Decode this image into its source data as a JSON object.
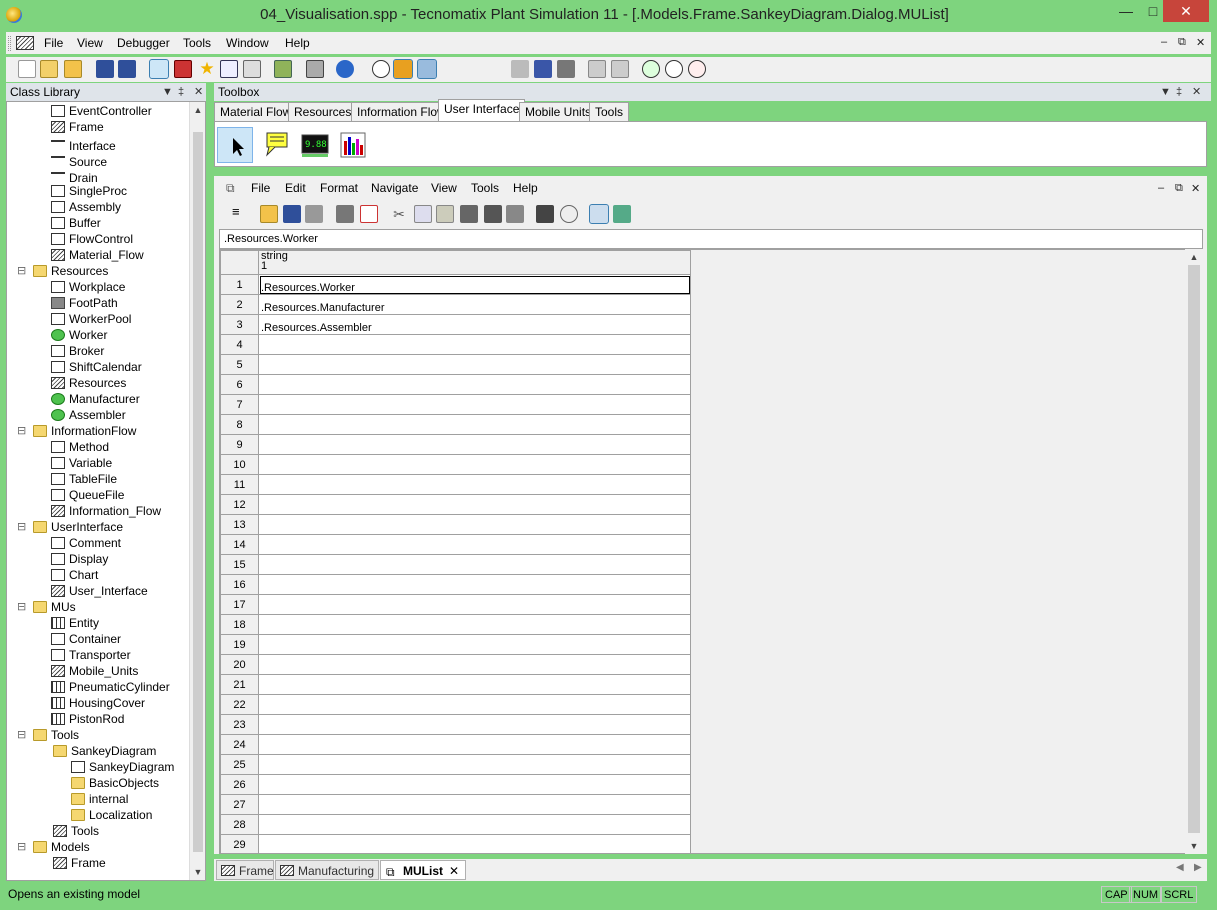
{
  "window": {
    "title": "04_Visualisation.spp - Tecnomatix Plant Simulation 11 - [.Models.Frame.SankeyDiagram.Dialog.MUList]"
  },
  "main_menu": [
    "File",
    "View",
    "Debugger",
    "Tools",
    "Window",
    "Help"
  ],
  "class_library": {
    "title": "Class Library",
    "items": [
      {
        "label": "EventController",
        "icon": "clock-icon"
      },
      {
        "label": "Frame",
        "icon": "frame-icon"
      },
      {
        "label": "Interface",
        "icon": "arrow-icon"
      },
      {
        "label": "Source",
        "icon": "source-icon"
      },
      {
        "label": "Drain",
        "icon": "drain-icon"
      },
      {
        "label": "SingleProc",
        "icon": "singleproc-icon"
      },
      {
        "label": "Assembly",
        "icon": "assembly-icon"
      },
      {
        "label": "Buffer",
        "icon": "buffer-icon"
      },
      {
        "label": "FlowControl",
        "icon": "flowcontrol-icon"
      },
      {
        "label": "Material_Flow",
        "icon": "frame-icon"
      },
      {
        "label": "Resources",
        "icon": "folder-icon"
      },
      {
        "label": "Workplace",
        "icon": "workplace-icon"
      },
      {
        "label": "FootPath",
        "icon": "footpath-icon"
      },
      {
        "label": "WorkerPool",
        "icon": "workerpool-icon"
      },
      {
        "label": "Worker",
        "icon": "worker-icon"
      },
      {
        "label": "Broker",
        "icon": "broker-icon"
      },
      {
        "label": "ShiftCalendar",
        "icon": "calendar-icon"
      },
      {
        "label": "Resources",
        "icon": "frame-icon"
      },
      {
        "label": "Manufacturer",
        "icon": "worker-icon"
      },
      {
        "label": "Assembler",
        "icon": "worker-icon"
      },
      {
        "label": "InformationFlow",
        "icon": "folder-icon"
      },
      {
        "label": "Method",
        "icon": "method-icon"
      },
      {
        "label": "Variable",
        "icon": "variable-icon"
      },
      {
        "label": "TableFile",
        "icon": "table-icon"
      },
      {
        "label": "QueueFile",
        "icon": "queue-icon"
      },
      {
        "label": "Information_Flow",
        "icon": "frame-icon"
      },
      {
        "label": "UserInterface",
        "icon": "folder-icon"
      },
      {
        "label": "Comment",
        "icon": "comment-icon"
      },
      {
        "label": "Display",
        "icon": "display-icon"
      },
      {
        "label": "Chart",
        "icon": "chart-icon"
      },
      {
        "label": "User_Interface",
        "icon": "frame-icon"
      },
      {
        "label": "MUs",
        "icon": "folder-icon"
      },
      {
        "label": "Entity",
        "icon": "entity-icon"
      },
      {
        "label": "Container",
        "icon": "container-icon"
      },
      {
        "label": "Transporter",
        "icon": "transporter-icon"
      },
      {
        "label": "Mobile_Units",
        "icon": "frame-icon"
      },
      {
        "label": "PneumaticCylinder",
        "icon": "entity-icon"
      },
      {
        "label": "HousingCover",
        "icon": "entity-icon"
      },
      {
        "label": "PistonRod",
        "icon": "entity-icon"
      },
      {
        "label": "Tools",
        "icon": "folder-icon"
      },
      {
        "label": "SankeyDiagram",
        "icon": "folder-icon"
      },
      {
        "label": "SankeyDiagram",
        "icon": "sankey-icon"
      },
      {
        "label": "BasicObjects",
        "icon": "folder-icon"
      },
      {
        "label": "internal",
        "icon": "folder-icon"
      },
      {
        "label": "Localization",
        "icon": "folder-icon"
      },
      {
        "label": "Tools",
        "icon": "frame-icon"
      },
      {
        "label": "Models",
        "icon": "folder-icon"
      },
      {
        "label": "Frame",
        "icon": "frame-icon"
      }
    ]
  },
  "toolbox": {
    "title": "Toolbox",
    "tabs": [
      "Material Flow",
      "Resources",
      "Information Flow",
      "User Interface",
      "Mobile Units",
      "Tools"
    ],
    "active_tab": "User Interface"
  },
  "mulist": {
    "menu": [
      "File",
      "Edit",
      "Format",
      "Navigate",
      "View",
      "Tools",
      "Help"
    ],
    "address": ".Resources.Worker",
    "column_type": "string",
    "column_index": "1",
    "rows": [
      ".Resources.Worker",
      ".Resources.Manufacturer",
      ".Resources.Assembler",
      "",
      "",
      "",
      "",
      "",
      "",
      "",
      "",
      "",
      "",
      "",
      "",
      "",
      "",
      "",
      "",
      "",
      "",
      "",
      "",
      "",
      "",
      "",
      "",
      "",
      ""
    ]
  },
  "doc_tabs": [
    "Frame",
    "Manufacturing",
    "MUList"
  ],
  "active_doc_tab": "MUList",
  "status": {
    "text": "Opens an existing model",
    "indicators": [
      "CAP",
      "NUM",
      "SCRL"
    ]
  }
}
